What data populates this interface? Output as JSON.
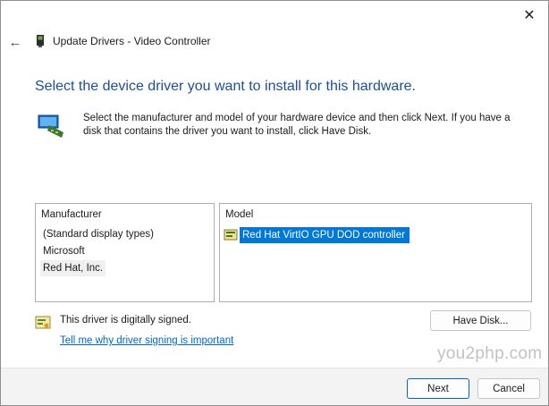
{
  "window": {
    "title": "Update Drivers - Video Controller",
    "close_icon": "close-icon",
    "back_icon": "back-arrow-icon"
  },
  "main": {
    "heading": "Select the device driver you want to install for this hardware.",
    "description": "Select the manufacturer and model of your hardware device and then click Next. If you have a disk that contains the driver you want to install, click Have Disk."
  },
  "manufacturer_list": {
    "header": "Manufacturer",
    "items": [
      "(Standard display types)",
      "Microsoft",
      "Red Hat, Inc."
    ],
    "selected": "Red Hat, Inc."
  },
  "model_list": {
    "header": "Model",
    "items": [
      "Red Hat VirtIO GPU DOD controller"
    ],
    "selected": "Red Hat VirtIO GPU DOD controller"
  },
  "signing": {
    "status": "This driver is digitally signed.",
    "link": "Tell me why driver signing is important"
  },
  "buttons": {
    "have_disk": "Have Disk...",
    "next": "Next",
    "cancel": "Cancel"
  },
  "watermark": "you2php.com",
  "colors": {
    "heading": "#1b4f9c",
    "selection": "#0078d7",
    "link": "#0066cc"
  }
}
